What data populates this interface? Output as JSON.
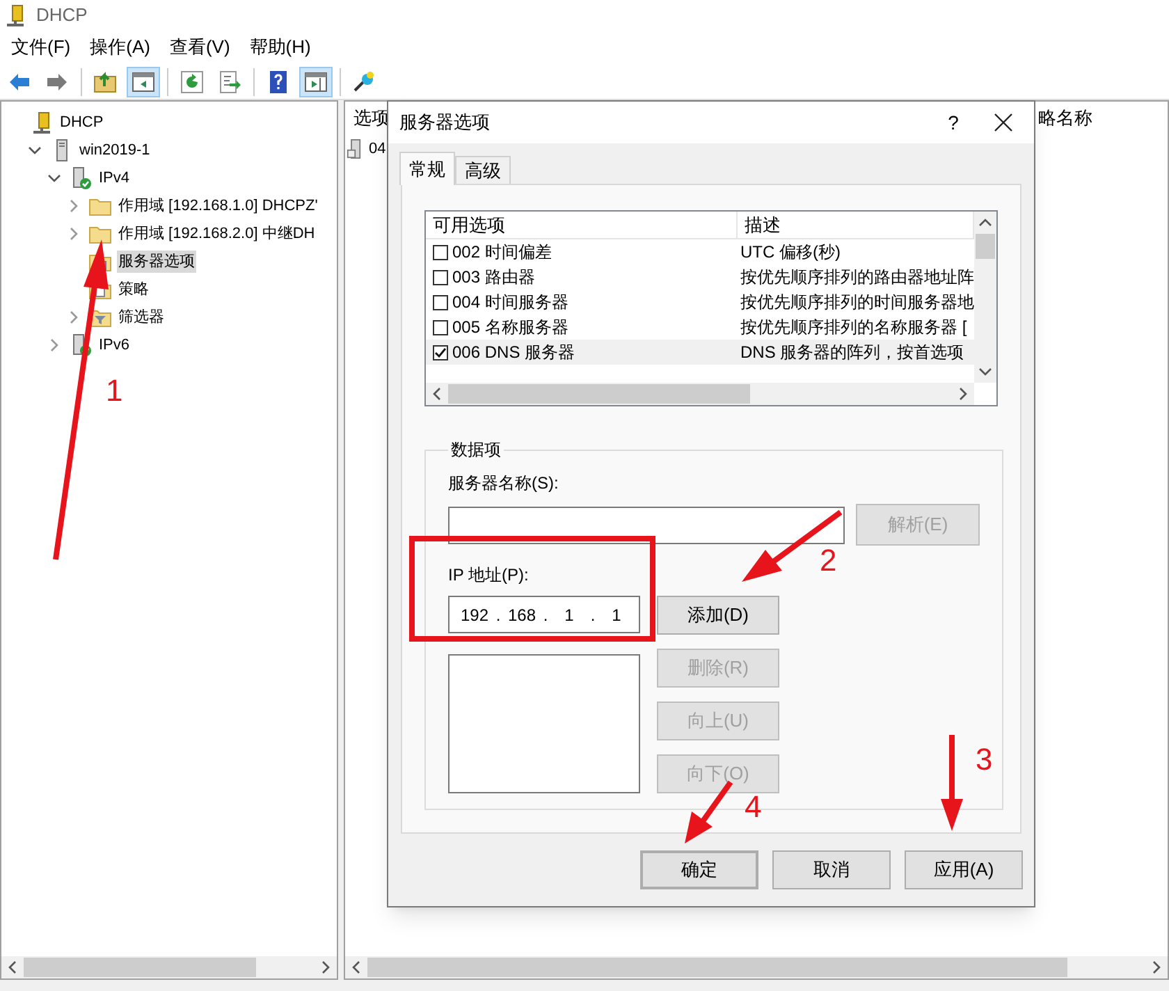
{
  "window": {
    "title": "DHCP"
  },
  "menu": [
    {
      "label": "文件(F)"
    },
    {
      "label": "操作(A)"
    },
    {
      "label": "查看(V)"
    },
    {
      "label": "帮助(H)"
    }
  ],
  "toolbar": [
    {
      "kind": "back",
      "pressed": false
    },
    {
      "kind": "forward",
      "pressed": false
    },
    {
      "kind": "sep"
    },
    {
      "kind": "up",
      "pressed": false
    },
    {
      "kind": "tree",
      "pressed": true
    },
    {
      "kind": "sep"
    },
    {
      "kind": "refresh",
      "pressed": false
    },
    {
      "kind": "export",
      "pressed": false
    },
    {
      "kind": "sep"
    },
    {
      "kind": "help",
      "pressed": false
    },
    {
      "kind": "actions",
      "pressed": true
    },
    {
      "kind": "sep"
    },
    {
      "kind": "plugin",
      "pressed": false
    }
  ],
  "tree": [
    {
      "label": "DHCP",
      "kind": "root",
      "selected": false,
      "children": [
        {
          "label": "win2019-1",
          "kind": "server",
          "selected": false,
          "expanded": true,
          "children": [
            {
              "label": "IPv4",
              "kind": "ip",
              "selected": false,
              "expanded": true,
              "children": [
                {
                  "label": "作用域 [192.168.1.0] DHCPZ'",
                  "kind": "folder",
                  "selected": false,
                  "expanded": false
                },
                {
                  "label": "作用域 [192.168.2.0] 中继DH",
                  "kind": "folder",
                  "selected": false,
                  "expanded": false
                },
                {
                  "label": "服务器选项",
                  "kind": "options",
                  "selected": true
                },
                {
                  "label": "策略",
                  "kind": "policy",
                  "selected": false
                },
                {
                  "label": "筛选器",
                  "kind": "filter",
                  "selected": false,
                  "expanded": false
                }
              ]
            },
            {
              "label": "IPv6",
              "kind": "ip",
              "selected": false,
              "expanded": false
            }
          ]
        }
      ]
    }
  ],
  "right_pane": {
    "column_1": "选项",
    "column_2": "略名称",
    "rows": [
      {
        "cell": "04"
      }
    ]
  },
  "dialog": {
    "title": "服务器选项",
    "help_label": "?",
    "tabs": [
      {
        "label": "常规",
        "selected": true
      },
      {
        "label": "高级",
        "selected": false
      }
    ],
    "options_list": {
      "columns": [
        "可用选项",
        "描述"
      ],
      "rows": [
        {
          "option": "002 时间偏差",
          "description": "UTC 偏移(秒)",
          "checked": false,
          "selected": false
        },
        {
          "option": "003 路由器",
          "description": "按优先顺序排列的路由器地址阵",
          "checked": false,
          "selected": false
        },
        {
          "option": "004 时间服务器",
          "description": "按优先顺序排列的时间服务器地",
          "checked": false,
          "selected": false
        },
        {
          "option": "005 名称服务器",
          "description": "按优先顺序排列的名称服务器 [",
          "checked": false,
          "selected": false
        },
        {
          "option": "006 DNS 服务器",
          "description": "DNS 服务器的阵列，按首选项",
          "checked": true,
          "selected": true
        }
      ]
    },
    "data_group": {
      "title": "数据项",
      "server_name_label": "服务器名称(S):",
      "resolve_button": {
        "label": "解析(E)",
        "disabled": true
      },
      "ip_label": "IP 地址(P):",
      "ip_octets": [
        "192",
        "168",
        "1",
        "1"
      ],
      "ip_separator": ".",
      "buttons": [
        {
          "label": "添加(D)",
          "disabled": false
        },
        {
          "label": "删除(R)",
          "disabled": true
        },
        {
          "label": "向上(U)",
          "disabled": true
        },
        {
          "label": "向下(O)",
          "disabled": true
        }
      ]
    },
    "footer_buttons": [
      {
        "label": "确定",
        "default": true
      },
      {
        "label": "取消",
        "default": false
      },
      {
        "label": "应用(A)",
        "default": false
      }
    ]
  },
  "annotations": [
    {
      "label": "1"
    },
    {
      "label": "2"
    },
    {
      "label": "3"
    },
    {
      "label": "4"
    }
  ]
}
